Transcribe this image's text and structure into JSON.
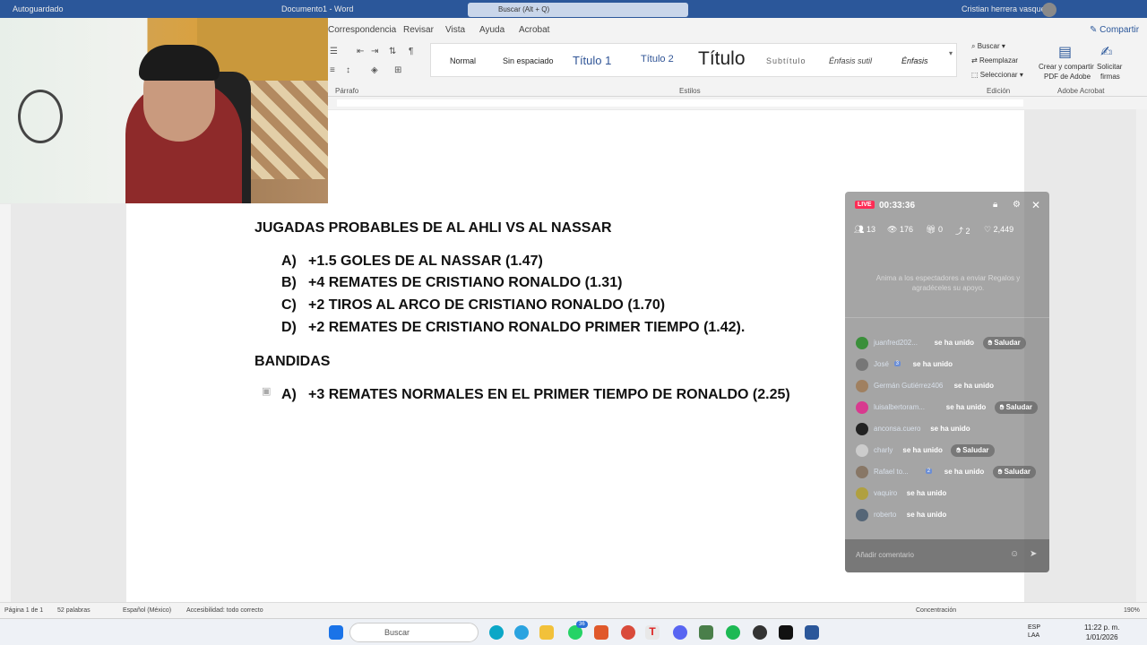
{
  "titlebar": {
    "autosave": "Autoguardado",
    "doc_title": "Documento1 - Word",
    "search_placeholder": "Buscar (Alt + Q)",
    "user_name": "Cristian herrera vasquez"
  },
  "ribbon": {
    "tabs": [
      "Correspondencia",
      "Revisar",
      "Vista",
      "Ayuda",
      "Acrobat"
    ],
    "share": "Compartir",
    "styles": [
      "Normal",
      "Sin espaciado",
      "Título 1",
      "Título 2",
      "Título",
      "Subtítulo",
      "Énfasis sutil",
      "Énfasis"
    ],
    "group_paragraph": "Párrafo",
    "group_styles": "Estilos",
    "group_edit": "Edición",
    "group_adobe": "Adobe Acrobat",
    "edit": {
      "find": "Buscar",
      "replace": "Reemplazar",
      "select": "Seleccionar"
    },
    "adobe": {
      "create": "Crear y compartir",
      "create2": "PDF de Adobe",
      "sign": "Solicitar",
      "sign2": "firmas"
    }
  },
  "document": {
    "heading1": "JUGADAS PROBABLES DE AL AHLI VS AL NASSAR",
    "list1": [
      {
        "letter": "A)",
        "text": "+1.5 GOLES DE AL NASSAR (1.47)"
      },
      {
        "letter": "B)",
        "text": "+4 REMATES DE CRISTIANO RONALDO (1.31)"
      },
      {
        "letter": "C)",
        "text": "+2 TIROS AL ARCO DE CRISTIANO RONALDO (1.70)"
      },
      {
        "letter": "D)",
        "text": "+2 REMATES DE CRISTIANO RONALDO PRIMER TIEMPO (1.42)."
      }
    ],
    "heading2": "BANDIDAS",
    "list2": [
      {
        "letter": "A)",
        "text": "+3 REMATES NORMALES EN EL PRIMER TIEMPO DE RONALDO (2.25)"
      }
    ]
  },
  "live": {
    "badge": "LIVE",
    "timer": "00:33:36",
    "stats": {
      "members": "13",
      "viewers": "176",
      "gifts": "0",
      "shares": "2",
      "likes": "2,449"
    },
    "hint": "Anima a los espectadores a enviar Regalos y agradéceles su apoyo.",
    "joined_text": "se ha unido",
    "greet_label": "Saludar",
    "chat": [
      {
        "name": "juanfred202...",
        "level": "",
        "greet": true,
        "color": "#3a8f3a"
      },
      {
        "name": "José",
        "level": "3",
        "greet": false,
        "color": "#777777"
      },
      {
        "name": "Germán Gutiérrez406",
        "level": "",
        "greet": false,
        "color": "#a08060"
      },
      {
        "name": "luisalbertoram...",
        "level": "",
        "greet": true,
        "color": "#d83a8f"
      },
      {
        "name": "anconsa.cuero",
        "level": "",
        "greet": false,
        "color": "#222222"
      },
      {
        "name": "charly",
        "level": "",
        "greet": true,
        "color": "#cccccc"
      },
      {
        "name": "Rafael to...",
        "level": "2",
        "greet": true,
        "color": "#887766"
      },
      {
        "name": "vaquiro",
        "level": "",
        "greet": false,
        "color": "#b0a040"
      },
      {
        "name": "roberto",
        "level": "",
        "greet": false,
        "color": "#556677"
      }
    ],
    "comment_placeholder": "Añadir comentario"
  },
  "statusbar": {
    "page": "Página 1 de 1",
    "words": "52 palabras",
    "language": "Español (México)",
    "accessibility": "Accesibilidad: todo correcto",
    "focus": "Concentración",
    "zoom": "190%"
  },
  "taskbar": {
    "search": "Buscar",
    "lang": "ESP",
    "lang2": "LAA",
    "time": "11:22 p. m.",
    "date": "1/01/2026",
    "whatsapp_badge": "36"
  }
}
